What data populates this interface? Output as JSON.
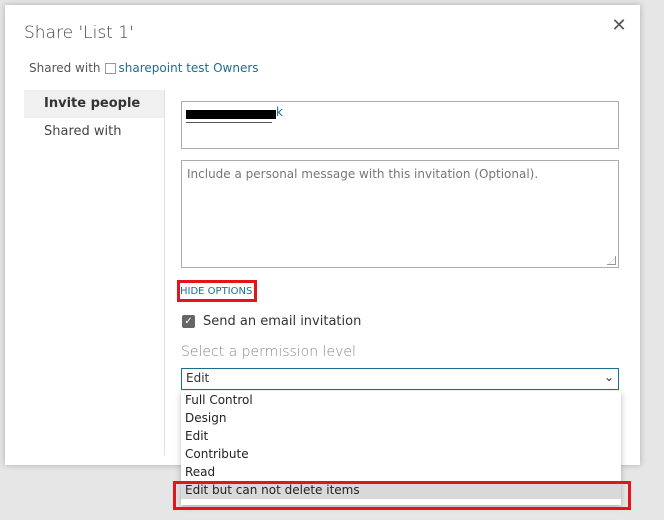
{
  "dialog": {
    "title": "Share 'List 1'",
    "close_label": "✕",
    "shared_with_label": "Shared with",
    "shared_with_link": "sharepoint test Owners"
  },
  "nav": {
    "items": [
      {
        "label": "Invite people",
        "active": true
      },
      {
        "label": "Shared with",
        "active": false
      }
    ]
  },
  "form": {
    "people_value_tail": "k",
    "message_placeholder": "Include a personal message with this invitation (Optional).",
    "hide_options_label": "HIDE OPTIONS",
    "send_email_label": "Send an email invitation",
    "send_email_checked": true,
    "permission_label": "Select a permission level",
    "permission_selected": "Edit"
  },
  "dropdown": {
    "options": [
      "Full Control",
      "Design",
      "Edit",
      "Contribute",
      "Read",
      "Edit but can not delete items"
    ],
    "highlighted_index": 5
  },
  "colors": {
    "accent": "#1b6f8c",
    "annotation_red": "#e3151a"
  }
}
